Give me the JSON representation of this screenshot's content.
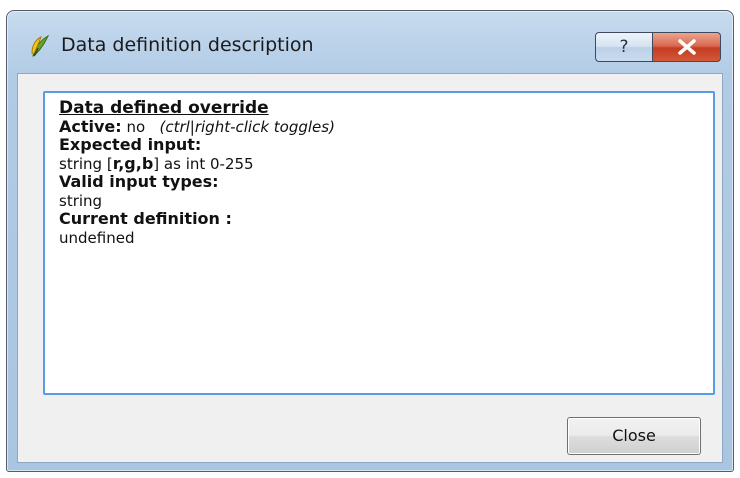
{
  "window": {
    "title": "Data definition description",
    "app_icon": "qgis-icon",
    "caption_buttons": {
      "help_label": "?",
      "close_icon": "close-icon"
    }
  },
  "description": {
    "heading": "Data defined override",
    "active_label": "Active:",
    "active_value": "no",
    "active_hint": "(ctrl|right-click toggles)",
    "expected_input_label": "Expected input:",
    "expected_prefix": "string [",
    "expected_bold": "r,g,b",
    "expected_suffix": "] as int 0-255",
    "valid_types_label": "Valid input types:",
    "valid_types_value": "string",
    "current_definition_label": "Current definition :",
    "current_definition_value": "undefined"
  },
  "footer": {
    "close_label": "Close"
  },
  "colors": {
    "focus_border": "#569de5",
    "close_button_red": "#c33d22",
    "titlebar": "#bcd3ea"
  }
}
